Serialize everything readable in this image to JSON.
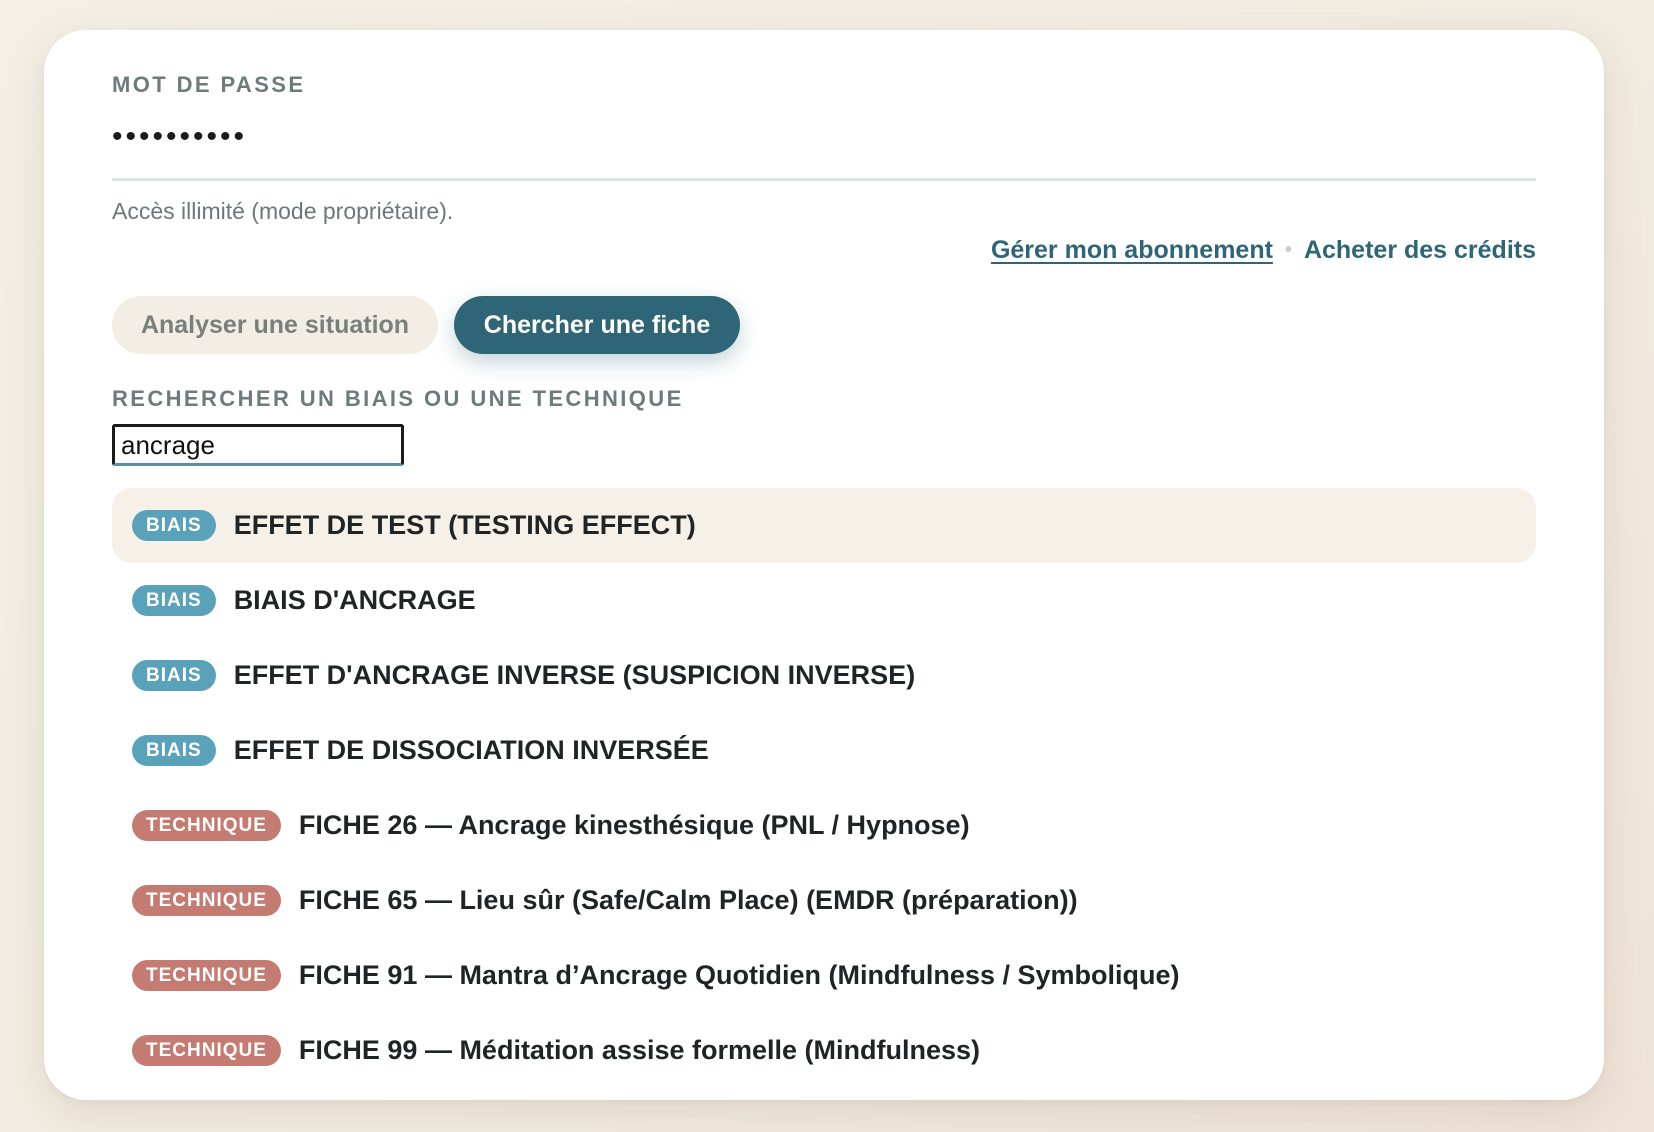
{
  "password": {
    "label": "MOT DE PASSE",
    "value": "••••••••••"
  },
  "access_note": "Accès illimité (mode propriétaire).",
  "links": {
    "manage_subscription": "Gérer mon abonnement",
    "separator": "•",
    "buy_credits": "Acheter des crédits"
  },
  "mode_buttons": {
    "analyse": "Analyser une situation",
    "search": "Chercher une fiche",
    "active": "search"
  },
  "search": {
    "label": "RECHERCHER UN BIAIS OU UNE TECHNIQUE",
    "value": "ancrage"
  },
  "results": [
    {
      "type": "BIAIS",
      "title": "EFFET DE TEST (TESTING EFFECT)",
      "highlighted": true
    },
    {
      "type": "BIAIS",
      "title": "BIAIS D'ANCRAGE"
    },
    {
      "type": "BIAIS",
      "title": "EFFET D'ANCRAGE INVERSE (SUSPICION INVERSE)"
    },
    {
      "type": "BIAIS",
      "title": "EFFET DE DISSOCIATION INVERSÉE"
    },
    {
      "type": "TECHNIQUE",
      "title": "FICHE 26 — Ancrage kinesthésique (PNL / Hypnose)"
    },
    {
      "type": "TECHNIQUE",
      "title": "FICHE 65 — Lieu sûr (Safe/Calm Place) (EMDR (préparation))"
    },
    {
      "type": "TECHNIQUE",
      "title": "FICHE 91 — Mantra d’Ancrage Quotidien (Mindfulness / Symbolique)"
    },
    {
      "type": "TECHNIQUE",
      "title": "FICHE 99 — Méditation assise formelle (Mindfulness)"
    }
  ],
  "colors": {
    "primary": "#2f6677",
    "biais_badge": "#5aa2b9",
    "technique_badge": "#c47b71",
    "highlight_row": "#f5f0e8"
  }
}
